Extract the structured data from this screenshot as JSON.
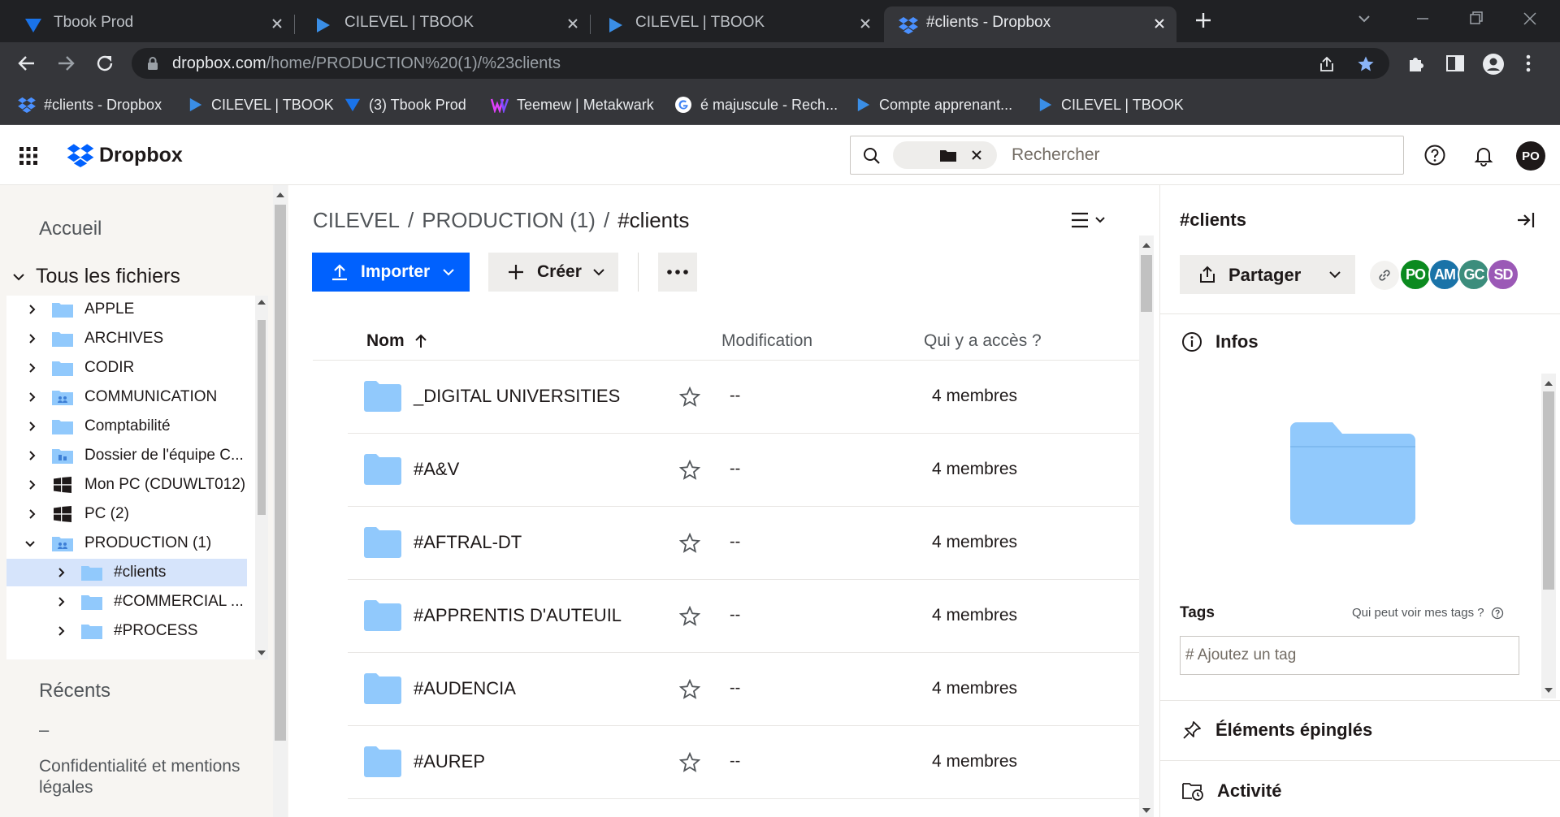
{
  "browser": {
    "tabs": [
      {
        "title": "Tbook Prod",
        "favicon": "tbook-icon",
        "active": false
      },
      {
        "title": "CILEVEL | TBOOK",
        "favicon": "cilevel-play-icon",
        "active": false
      },
      {
        "title": "CILEVEL | TBOOK",
        "favicon": "cilevel-play-icon",
        "active": false
      },
      {
        "title": "#clients - Dropbox",
        "favicon": "dropbox-icon",
        "active": true
      }
    ],
    "url_host": "dropbox.com",
    "url_path": "/home/PRODUCTION%20(1)/%23clients",
    "bookmarks": [
      {
        "label": "#clients - Dropbox",
        "icon": "dropbox-icon"
      },
      {
        "label": "CILEVEL | TBOOK",
        "icon": "cilevel-play-icon"
      },
      {
        "label": "(3) Tbook Prod",
        "icon": "tbook-icon"
      },
      {
        "label": "Teemew | Metakwark",
        "icon": "teemew-icon"
      },
      {
        "label": "é majuscule - Rech...",
        "icon": "google-icon"
      },
      {
        "label": "Compte apprenant...",
        "icon": "cilevel-play-icon"
      },
      {
        "label": "CILEVEL | TBOOK",
        "icon": "cilevel-play-icon"
      }
    ]
  },
  "header": {
    "brand": "Dropbox",
    "search_placeholder": "Rechercher",
    "avatar_initials": "PO"
  },
  "sidebar": {
    "home": "Accueil",
    "all_files": "Tous les fichiers",
    "tree": [
      {
        "label": "APPLE",
        "icon": "folder-icon"
      },
      {
        "label": "ARCHIVES",
        "icon": "folder-icon"
      },
      {
        "label": "CODIR",
        "icon": "folder-icon"
      },
      {
        "label": "COMMUNICATION",
        "icon": "shared-folder-icon"
      },
      {
        "label": "Comptabilité",
        "icon": "folder-icon"
      },
      {
        "label": "Dossier de l'équipe C...",
        "icon": "team-folder-icon"
      },
      {
        "label": "Mon PC (CDUWLT012)",
        "icon": "windows-icon"
      },
      {
        "label": "PC (2)",
        "icon": "windows-icon"
      },
      {
        "label": "PRODUCTION (1)",
        "icon": "shared-folder-icon"
      },
      {
        "label": "#clients",
        "icon": "folder-icon"
      },
      {
        "label": "#COMMERCIAL ...",
        "icon": "folder-icon"
      },
      {
        "label": "#PROCESS",
        "icon": "folder-icon"
      }
    ],
    "recent": "Récents",
    "dash": "–",
    "legal": "Confidentialité et mentions légales"
  },
  "main": {
    "breadcrumb": [
      "CILEVEL",
      "PRODUCTION (1)",
      "#clients"
    ],
    "import_label": "Importer",
    "create_label": "Créer",
    "columns": {
      "name": "Nom",
      "modified": "Modification",
      "access": "Qui y a accès ?"
    },
    "rows": [
      {
        "name": "_DIGITAL UNIVERSITIES",
        "modified": "--",
        "access": "4 membres"
      },
      {
        "name": "#A&V",
        "modified": "--",
        "access": "4 membres"
      },
      {
        "name": "#AFTRAL-DT",
        "modified": "--",
        "access": "4 membres"
      },
      {
        "name": "#APPRENTIS D'AUTEUIL",
        "modified": "--",
        "access": "4 membres"
      },
      {
        "name": "#AUDENCIA",
        "modified": "--",
        "access": "4 membres"
      },
      {
        "name": "#AUREP",
        "modified": "--",
        "access": "4 membres"
      }
    ]
  },
  "panel": {
    "title": "#clients",
    "share_label": "Partager",
    "members": [
      {
        "initials": "PO",
        "color": "#0b8a1f"
      },
      {
        "initials": "AM",
        "color": "#1a73a8"
      },
      {
        "initials": "GC",
        "color": "#3c8d7c"
      },
      {
        "initials": "SD",
        "color": "#9b59b6"
      }
    ],
    "info_label": "Infos",
    "tags_label": "Tags",
    "tags_who": "Qui peut voir mes tags ?",
    "tags_placeholder": "# Ajoutez un tag",
    "pinned_label": "Éléments épinglés",
    "activity_label": "Activité"
  },
  "colors": {
    "accent": "#0061fe",
    "folder": "#91c9fc",
    "sidebar_bg": "#f7f5f2"
  }
}
